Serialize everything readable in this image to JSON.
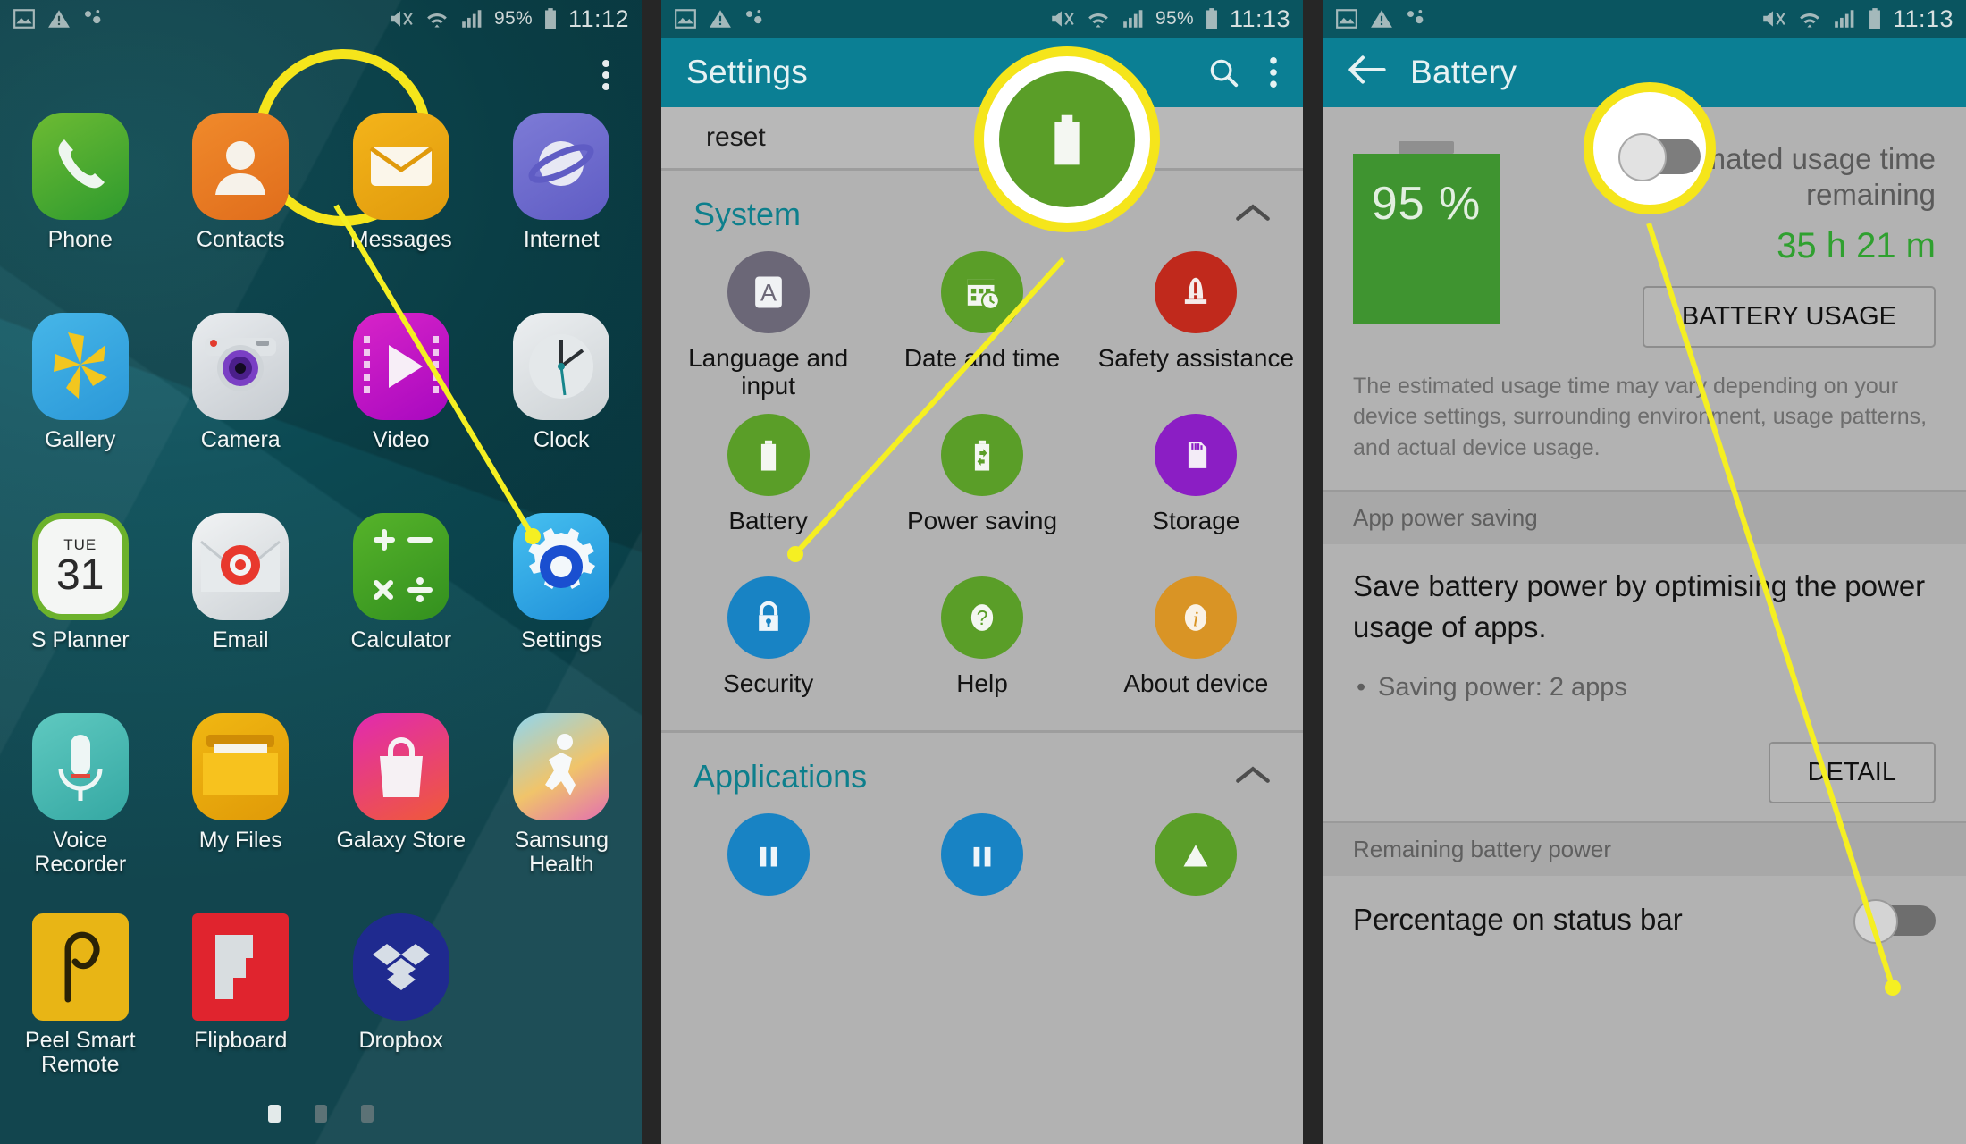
{
  "accent": {
    "teal_bar": "#0b7f94",
    "status_bar": "#0a5560",
    "highlight": "#f5e51b",
    "green": "#5a9e28",
    "gray_bg": "#b2b2b2"
  },
  "panels": {
    "home": {
      "status_bar": {
        "time": "11:12",
        "battery_percent": "95%",
        "left_icons": [
          "screenshot-icon",
          "warning-icon",
          "data-saver-icon"
        ],
        "right_icons": [
          "mute-icon",
          "wifi-icon",
          "signal-icon",
          "battery-icon"
        ]
      },
      "apps": [
        {
          "label": "Phone",
          "icon": "phone-icon"
        },
        {
          "label": "Contacts",
          "icon": "contacts-icon"
        },
        {
          "label": "Messages",
          "icon": "messages-icon"
        },
        {
          "label": "Internet",
          "icon": "internet-icon"
        },
        {
          "label": "Gallery",
          "icon": "gallery-icon"
        },
        {
          "label": "Camera",
          "icon": "camera-icon"
        },
        {
          "label": "Video",
          "icon": "video-icon"
        },
        {
          "label": "Clock",
          "icon": "clock-icon"
        },
        {
          "label": "S Planner",
          "icon": "calendar-icon"
        },
        {
          "label": "Email",
          "icon": "email-icon"
        },
        {
          "label": "Calculator",
          "icon": "calculator-icon"
        },
        {
          "label": "Settings",
          "icon": "gear-icon"
        },
        {
          "label": "Voice Recorder",
          "icon": "microphone-icon"
        },
        {
          "label": "My Files",
          "icon": "folder-icon"
        },
        {
          "label": "Galaxy Store",
          "icon": "shopping-bag-icon"
        },
        {
          "label": "Samsung Health",
          "icon": "runner-icon"
        },
        {
          "label": "Peel Smart Remote",
          "icon": "peel-icon"
        },
        {
          "label": "Flipboard",
          "icon": "flipboard-icon"
        },
        {
          "label": "Dropbox",
          "icon": "dropbox-icon"
        }
      ],
      "planner_day": "TUE",
      "planner_date": "31",
      "page_dots": 3
    },
    "settings": {
      "status_bar": {
        "time": "11:13",
        "battery_percent": "95%"
      },
      "title": "Settings",
      "actions": [
        "search-icon",
        "overflow-menu-icon"
      ],
      "partial_row": "reset",
      "sections": [
        {
          "title": "System",
          "collapsed": false,
          "items": [
            {
              "label": "Language and input",
              "icon": "language-icon",
              "color": "#6b6777"
            },
            {
              "label": "Date and time",
              "icon": "calendar-clock-icon",
              "color": "#5a9e28"
            },
            {
              "label": "Safety assistance",
              "icon": "alert-beacon-icon",
              "color": "#c0291c"
            },
            {
              "label": "Battery",
              "icon": "battery-icon",
              "color": "#5a9e28"
            },
            {
              "label": "Power saving",
              "icon": "power-saving-icon",
              "color": "#5a9e28"
            },
            {
              "label": "Storage",
              "icon": "sd-card-icon",
              "color": "#8b1ec4"
            },
            {
              "label": "Security",
              "icon": "lock-icon",
              "color": "#1883c4"
            },
            {
              "label": "Help",
              "icon": "question-icon",
              "color": "#5a9e28"
            },
            {
              "label": "About device",
              "icon": "info-icon",
              "color": "#d99425"
            }
          ]
        },
        {
          "title": "Applications",
          "collapsed": false,
          "items": []
        }
      ]
    },
    "battery": {
      "status_bar": {
        "time": "11:13",
        "battery_percent": ""
      },
      "title": "Battery",
      "back_icon": "back-arrow-icon",
      "battery_level": "95 %",
      "estimated_label": "Estimated usage time remaining",
      "estimated_time": "35 h 21 m",
      "usage_button": "BATTERY USAGE",
      "note": "The estimated usage time may vary depending on your device settings, surrounding environment, usage patterns, and actual device usage.",
      "app_power_saving": {
        "header": "App power saving",
        "description": "Save battery power by optimising the power usage of apps.",
        "bullet": "Saving power: 2 apps",
        "detail_button": "DETAIL"
      },
      "remaining": {
        "header": "Remaining battery power",
        "row_label": "Percentage on status bar",
        "toggle_state": "off"
      }
    }
  },
  "callouts": [
    {
      "target": "settings-app-icon",
      "shape": "ring"
    },
    {
      "target": "battery-settings-icon",
      "shape": "filled-ring"
    },
    {
      "target": "percentage-toggle",
      "shape": "filled-ring"
    }
  ]
}
